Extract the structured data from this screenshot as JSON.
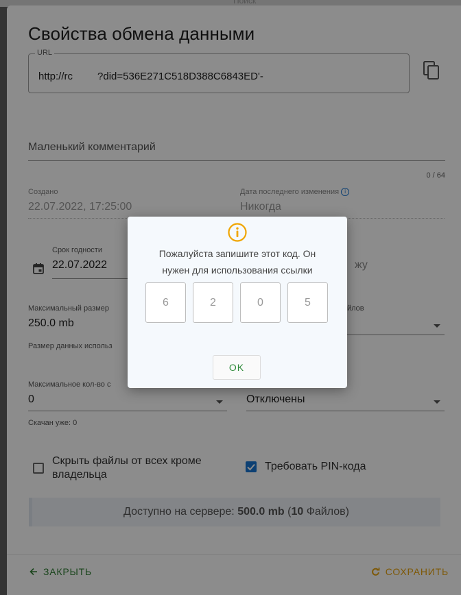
{
  "background": {
    "top_text": "Поиск"
  },
  "dialog": {
    "title": "Свойства обмена данными",
    "url": {
      "label": "URL",
      "value_start": "http://rc",
      "value_end": "?did=536E271C518D388C6843ED'-"
    },
    "comment": {
      "placeholder": "Маленький комментарий",
      "counter": "0 / 64"
    },
    "created": {
      "label": "Создано",
      "value": "22.07.2022, 17:25:00"
    },
    "modified": {
      "label": "Дата последнего изменения",
      "value": "Никогда"
    },
    "expiry": {
      "label": "Срок годности",
      "value": "22.07.2022",
      "right_partial": "жу"
    },
    "max_size": {
      "label": "Максимальный размер",
      "value": "250.0 mb",
      "helper": "Размер данных использ",
      "right_label_partial": "йлов"
    },
    "max_downloads": {
      "label": "Максимальное кол-во с",
      "value": "0",
      "helper": "Скачан уже: 0",
      "right_value": "Отключены"
    },
    "hide_files": {
      "label_line1": "Скрыть файлы от всех кроме",
      "label_line2": "владельца",
      "checked": false
    },
    "require_pin": {
      "label": "Требовать PIN-кода",
      "checked": true
    },
    "availability": {
      "prefix": "Доступно на сервере: ",
      "size": "500.0 mb",
      "open": " (",
      "count": "10",
      "files": " Файлов)"
    },
    "footer": {
      "close_label": "ЗАКРЫТЬ",
      "save_label": "СОХРАНИТЬ"
    }
  },
  "popup": {
    "message_line1": "Пожалуйста запишите этот код. Он",
    "message_line2": "нужен для использования ссылки",
    "code": [
      "6",
      "2",
      "0",
      "5"
    ],
    "ok_label": "OK"
  },
  "colors": {
    "accent_blue": "#1976d2",
    "green": "#2e7d32",
    "orange": "#e6a20f",
    "info_orange": "#f0a500"
  }
}
